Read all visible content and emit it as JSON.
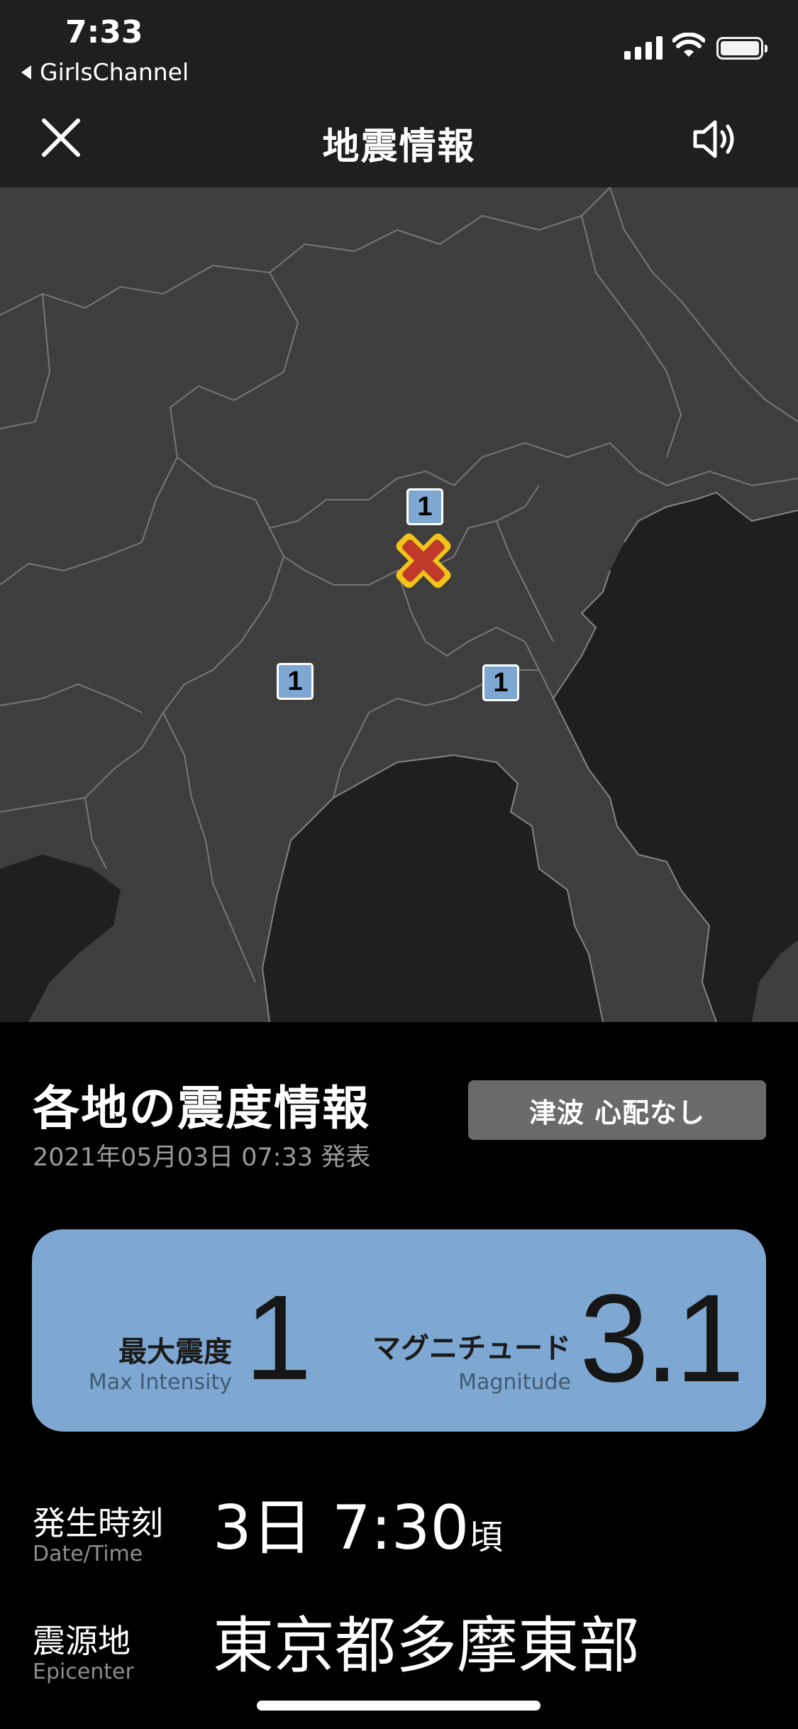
{
  "status_bar": {
    "time": "7:33",
    "back_app": "GirlsChannel"
  },
  "nav": {
    "title": "地震情報",
    "close_icon": "close-icon",
    "sound_icon": "speaker-icon"
  },
  "map": {
    "epicenter_icon": "epicenter-cross-icon",
    "intensity_markers": [
      "1",
      "1",
      "1"
    ],
    "colors": {
      "land": "#3e3e3e",
      "sea": "#1f1f1f",
      "border": "#8a8a8a",
      "marker": "#7ea8d2",
      "epicenter_fill": "#c0392b",
      "epicenter_outline": "#f0c419"
    }
  },
  "info": {
    "section_title": "各地の震度情報",
    "announced": "2021年05月03日 07:33 発表",
    "tsunami": "津波 心配なし",
    "max_intensity": {
      "label_jp": "最大震度",
      "label_en": "Max Intensity",
      "value": "1"
    },
    "magnitude": {
      "label_jp": "マグニチュード",
      "label_en": "Magnitude",
      "value": "3.1"
    },
    "datetime": {
      "label_jp": "発生時刻",
      "label_en": "Date/Time",
      "value": "3日 7:30",
      "suffix": "頃"
    },
    "epicenter": {
      "label_jp": "震源地",
      "label_en": "Epicenter",
      "value": "東京都多摩東部"
    },
    "card_color": "#7ea8d2"
  }
}
